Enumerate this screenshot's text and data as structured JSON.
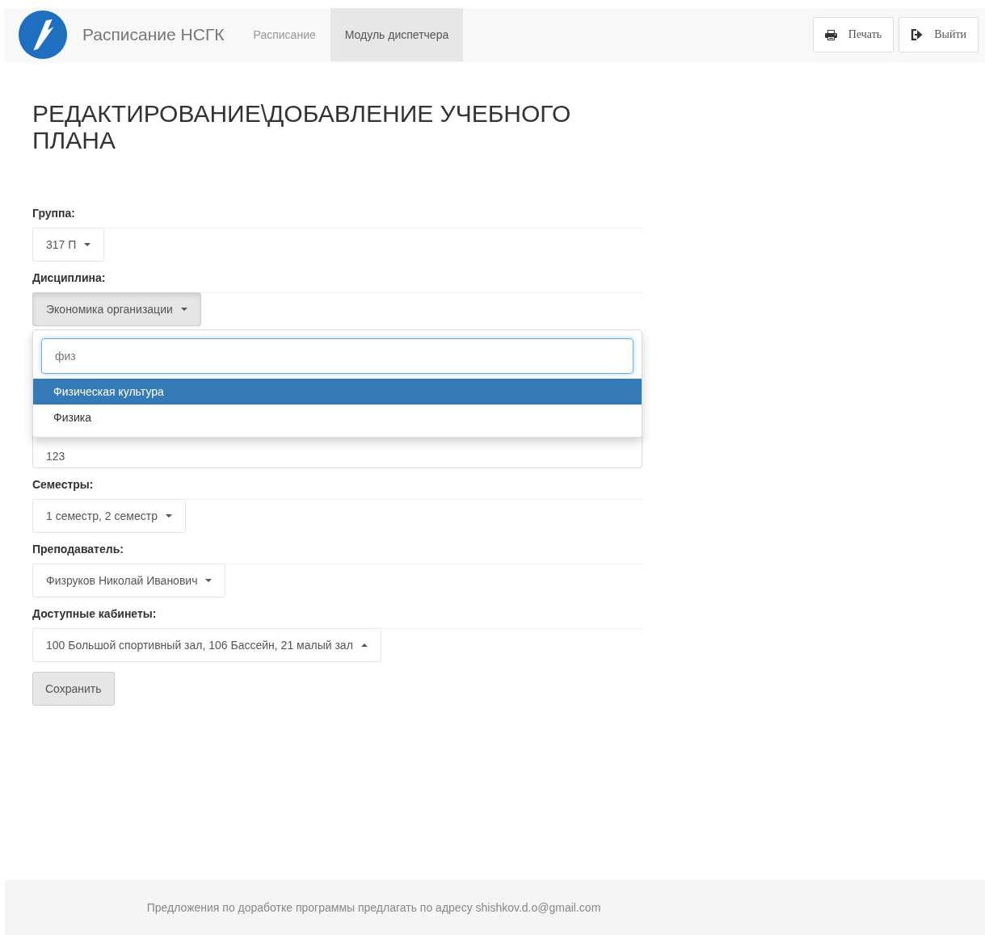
{
  "navbar": {
    "brand": "Расписание НСГК",
    "links": [
      {
        "label": "Расписание",
        "selected": false
      },
      {
        "label": "Модуль диспетчера",
        "selected": true
      }
    ],
    "buttons": [
      {
        "label": "Печать",
        "kind": "print"
      },
      {
        "label": "Выйти",
        "kind": "logout"
      }
    ]
  },
  "heading": "РЕДАКТИРОВАНИЕ\\ДОБАВЛЕНИЕ УЧЕБНОГО ПЛАНА",
  "fields": [
    {
      "kind": "select",
      "label": "Группа:",
      "value": "317 П",
      "active": false,
      "dropup": false
    },
    {
      "kind": "select",
      "label": "Дисциплина:",
      "value": "Экономика организации",
      "active": true,
      "dropup": false
    },
    {
      "kind": "input",
      "value": "123"
    },
    {
      "kind": "select",
      "label": "Семестры:",
      "value": "1 семестр, 2 семестр",
      "active": false,
      "dropup": false
    },
    {
      "kind": "select",
      "label": "Преподаватель:",
      "value": "Физруков Николай Иванович",
      "active": false,
      "dropup": false
    },
    {
      "kind": "select",
      "label": "Доступные кабинеты:",
      "value": "100 Большой спортивный зал, 106 Бассейн, 21 малый зал",
      "active": false,
      "dropup": true
    }
  ],
  "dropdown": {
    "search": "физ",
    "options": [
      {
        "label": "Физическая культура",
        "selected": true
      },
      {
        "label": "Физика",
        "selected": false
      }
    ]
  },
  "save_button": "Сохранить",
  "footer": "Предложения по доработке программы предлагать по адресу shishkov.d.o@gmail.com"
}
